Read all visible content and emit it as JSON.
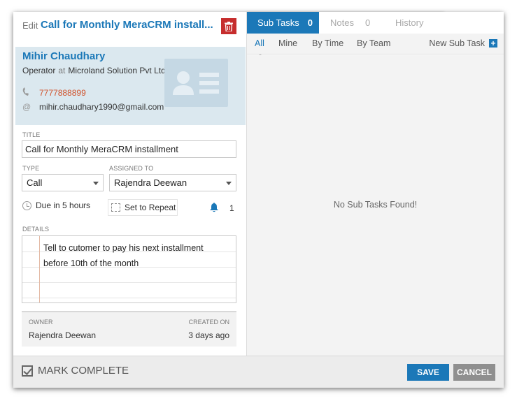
{
  "header": {
    "prefix": "Edit",
    "title": "Call for Monthly MeraCRM install..."
  },
  "contact": {
    "name": "Mihir Chaudhary",
    "role": "Operator",
    "at": "at",
    "company": "Microland Solution Pvt Ltd",
    "phone": "7777888899",
    "email": "mihir.chaudhary1990@gmail.com"
  },
  "form": {
    "title_label": "TITLE",
    "title_value": "Call for Monthly MeraCRM installment",
    "type_label": "TYPE",
    "type_value": "Call",
    "assigned_label": "ASSIGNED TO",
    "assigned_value": "Rajendra Deewan",
    "due": "Due in 5 hours",
    "repeat": "Set to Repeat",
    "reminder_count": "1",
    "details_label": "DETAILS",
    "details_line1": "Tell to cutomer to pay his next installment",
    "details_line2": "before 10th of the month"
  },
  "owner": {
    "owner_label": "OWNER",
    "owner_value": "Rajendra Deewan",
    "created_label": "CREATED ON",
    "created_value": "3 days ago"
  },
  "tabs": {
    "subtasks": "Sub Tasks",
    "subtasks_count": "0",
    "notes": "Notes",
    "notes_count": "0",
    "history": "History"
  },
  "subtabs": {
    "all": "All",
    "mine": "Mine",
    "by_time": "By Time",
    "by_team": "By Team",
    "new_subtask": "New Sub Task"
  },
  "empty_message": "No Sub Tasks Found!",
  "footer": {
    "mark_complete": "MARK COMPLETE",
    "save": "SAVE",
    "cancel": "CANCEL"
  },
  "colors": {
    "accent": "#1b78b8",
    "delete": "#c62d2d",
    "phone": "#d0522b"
  }
}
